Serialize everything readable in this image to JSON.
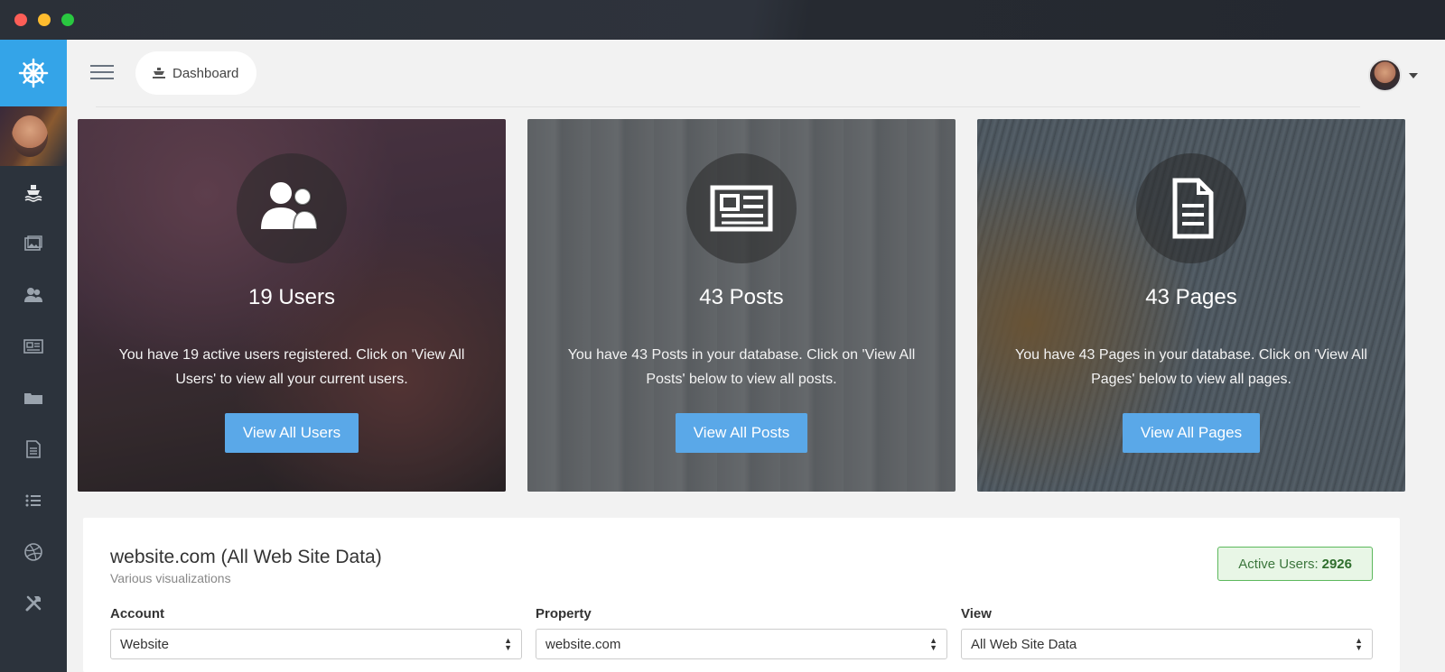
{
  "window": {
    "controls": [
      "close",
      "minimize",
      "maximize"
    ]
  },
  "sidebar": {
    "brand_icon": "ship-wheel-icon",
    "items": [
      {
        "icon": "ship-icon"
      },
      {
        "icon": "image-icon"
      },
      {
        "icon": "users-icon"
      },
      {
        "icon": "newspaper-icon"
      },
      {
        "icon": "folder-icon"
      },
      {
        "icon": "document-icon"
      },
      {
        "icon": "list-icon"
      },
      {
        "icon": "dribbble-icon"
      },
      {
        "icon": "tools-icon"
      }
    ]
  },
  "topbar": {
    "breadcrumb": "Dashboard",
    "breadcrumb_icon": "ship-icon"
  },
  "cards": [
    {
      "title": "19 Users",
      "text": "You have 19 active users registered. Click on 'View All Users' to view all your current users.",
      "button": "View All Users",
      "icon": "users-icon"
    },
    {
      "title": "43 Posts",
      "text": "You have 43 Posts in your database. Click on 'View All Posts' below to view all posts.",
      "button": "View All Posts",
      "icon": "newspaper-icon"
    },
    {
      "title": "43 Pages",
      "text": "You have 43 Pages in your database. Click on 'View All Pages' below to view all pages.",
      "button": "View All Pages",
      "icon": "document-icon"
    }
  ],
  "panel": {
    "title": "website.com (All Web Site Data)",
    "subtitle": "Various visualizations",
    "active_users_label": "Active Users:",
    "active_users_value": "2926",
    "fields": [
      {
        "label": "Account",
        "value": "Website"
      },
      {
        "label": "Property",
        "value": "website.com"
      },
      {
        "label": "View",
        "value": "All Web Site Data"
      }
    ]
  },
  "colors": {
    "brand": "#34a4e8",
    "sidebar": "#2c333c",
    "button": "#5aa8e8",
    "success": "#5cb85c"
  }
}
